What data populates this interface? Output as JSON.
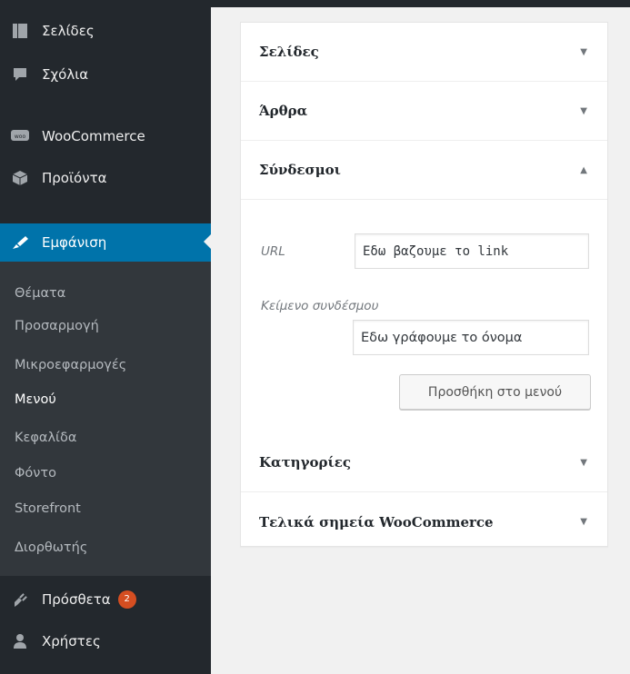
{
  "sidebar": {
    "menu": [
      {
        "label": "Σελίδες",
        "icon": "pages-icon"
      },
      {
        "label": "Σχόλια",
        "icon": "comments-icon"
      },
      {
        "label": "WooCommerce",
        "icon": "woocommerce-icon"
      },
      {
        "label": "Προϊόντα",
        "icon": "products-icon"
      },
      {
        "label": "Εμφάνιση",
        "icon": "appearance-icon"
      },
      {
        "label": "Πρόσθετα",
        "icon": "plugins-icon",
        "badge": "2"
      },
      {
        "label": "Χρήστες",
        "icon": "users-icon"
      }
    ],
    "submenu": [
      "Θέματα",
      "Προσαρμογή",
      "Μικροεφαρμογές",
      "Μενού",
      "Κεφαλίδα",
      "Φόντο",
      "Storefront",
      "Διορθωτής"
    ]
  },
  "panel": {
    "sections": [
      {
        "title": "Σελίδες",
        "arrow": "▼"
      },
      {
        "title": "Άρθρα",
        "arrow": "▼"
      },
      {
        "title": "Σύνδεσμοι",
        "arrow": "▲"
      },
      {
        "title": "Κατηγορίες",
        "arrow": "▼"
      },
      {
        "title": "Τελικά σημεία WooCommerce",
        "arrow": "▼"
      }
    ],
    "links": {
      "url_label": "URL",
      "url_value": "Εδω βαζουμε το link",
      "text_label": "Κείμενο συνδέσμου",
      "text_value": "Εδω γράφουμε το όνομα",
      "add_button": "Προσθήκη στο μενού"
    }
  },
  "colors": {
    "sidebar": "#23282d",
    "submenu": "#32373c",
    "accent": "#0073aa",
    "badge": "#d54e21"
  }
}
